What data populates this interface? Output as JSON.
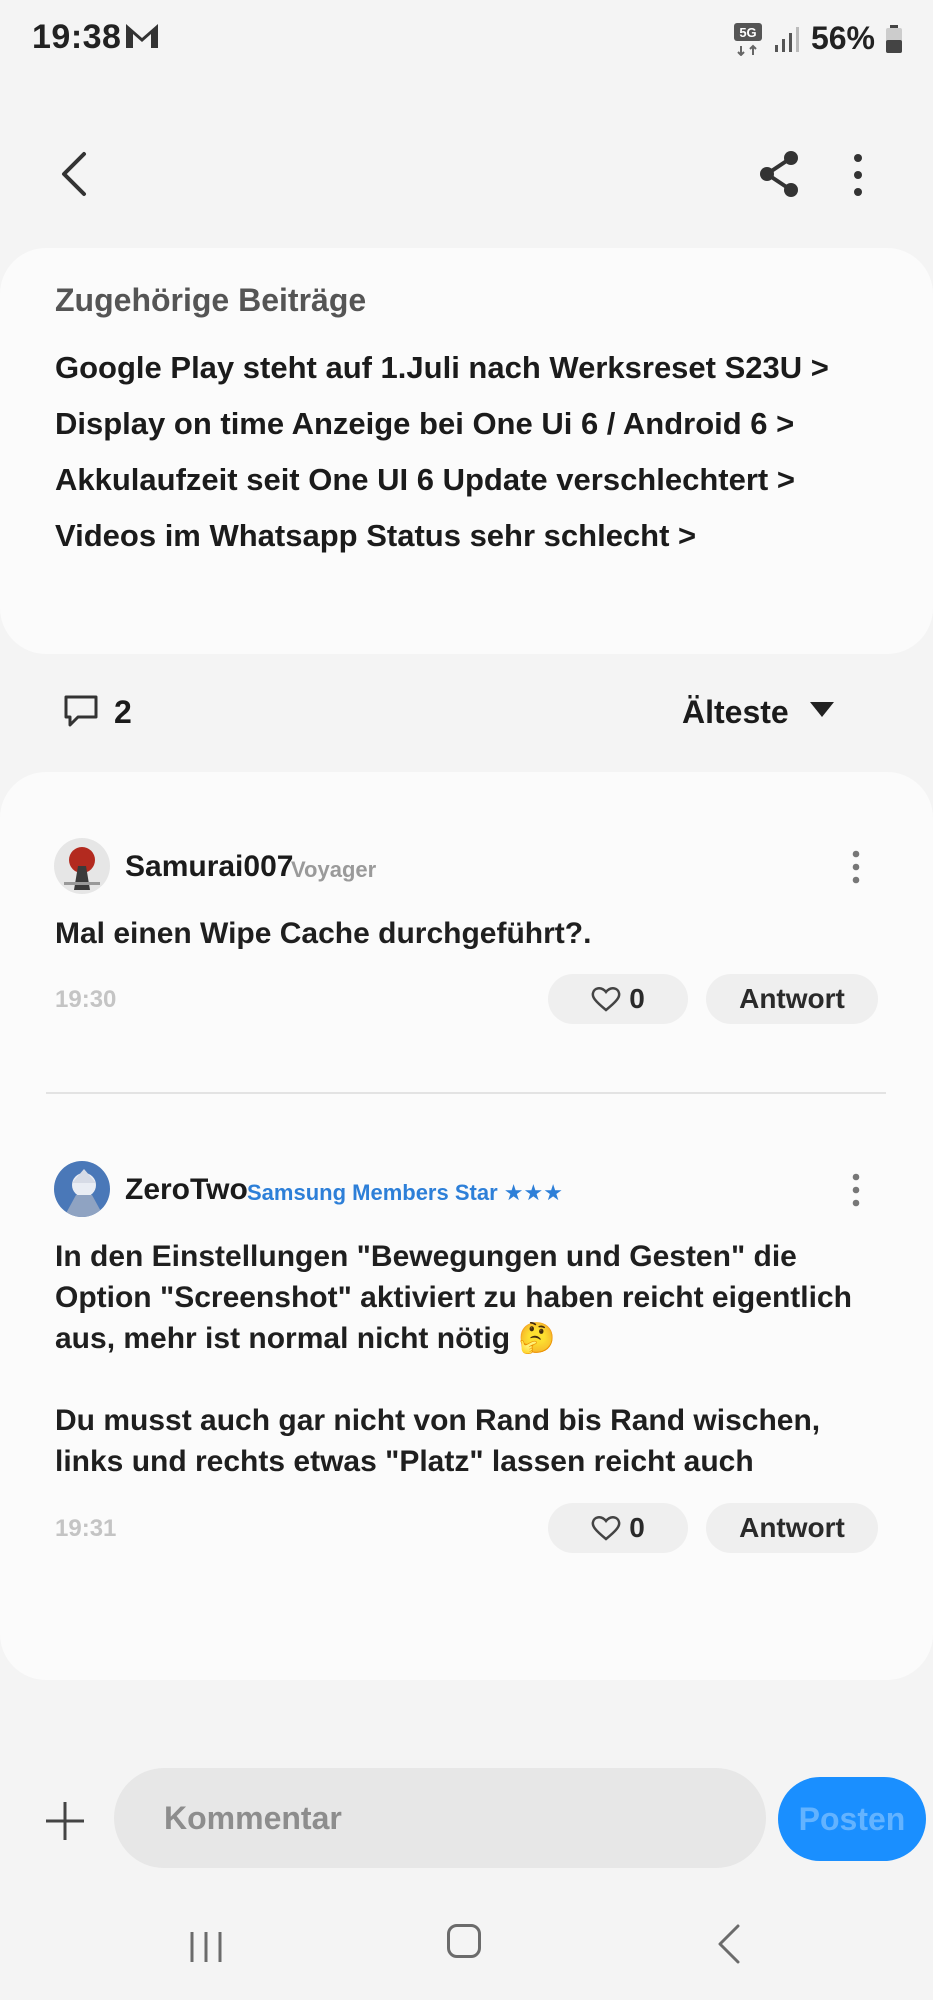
{
  "status_bar": {
    "time": "19:38",
    "notification_icon": "gmail-m-icon",
    "network": "5G",
    "battery": "56%"
  },
  "app_bar": {
    "back_icon": "chevron-left-icon",
    "share_icon": "share-icon",
    "more_icon": "more-vertical-icon"
  },
  "related": {
    "title": "Zugehörige Beiträge",
    "links": [
      "Google Play steht auf 1.Juli nach Werksreset S23U >",
      "Display on time Anzeige bei One Ui 6 / Android 6 >",
      "Akkulaufzeit seit One UI 6 Update verschlechtert >",
      "Videos im Whatsapp Status sehr schlecht >"
    ]
  },
  "comments_header": {
    "count": "2",
    "sort_label": "Älteste"
  },
  "comments": [
    {
      "username": "Samurai007",
      "rank": "Voyager",
      "rank_stars": "",
      "text_lines": [
        "Mal einen Wipe Cache durchgeführt?."
      ],
      "time": "19:30",
      "likes": "0",
      "reply_label": "Antwort"
    },
    {
      "username": "ZeroTwo",
      "rank": "Samsung Members Star",
      "rank_stars": "★★★",
      "text_lines": [
        "In den Einstellungen \"Bewegungen und Gesten\" die",
        "Option \"Screenshot\" aktiviert zu haben reicht eigentlich",
        "aus, mehr ist normal nicht nötig 🤔",
        "",
        "Du musst auch gar nicht von Rand bis Rand wischen,",
        "links und rechts etwas \"Platz\" lassen reicht auch"
      ],
      "time": "19:31",
      "likes": "0",
      "reply_label": "Antwort"
    }
  ],
  "composer": {
    "placeholder": "Kommentar",
    "post_label": "Posten"
  },
  "colors": {
    "accent": "#1a8fff",
    "rank_blue": "#2d7fd8",
    "background": "#f4f4f4",
    "card": "#fbfbfb"
  }
}
